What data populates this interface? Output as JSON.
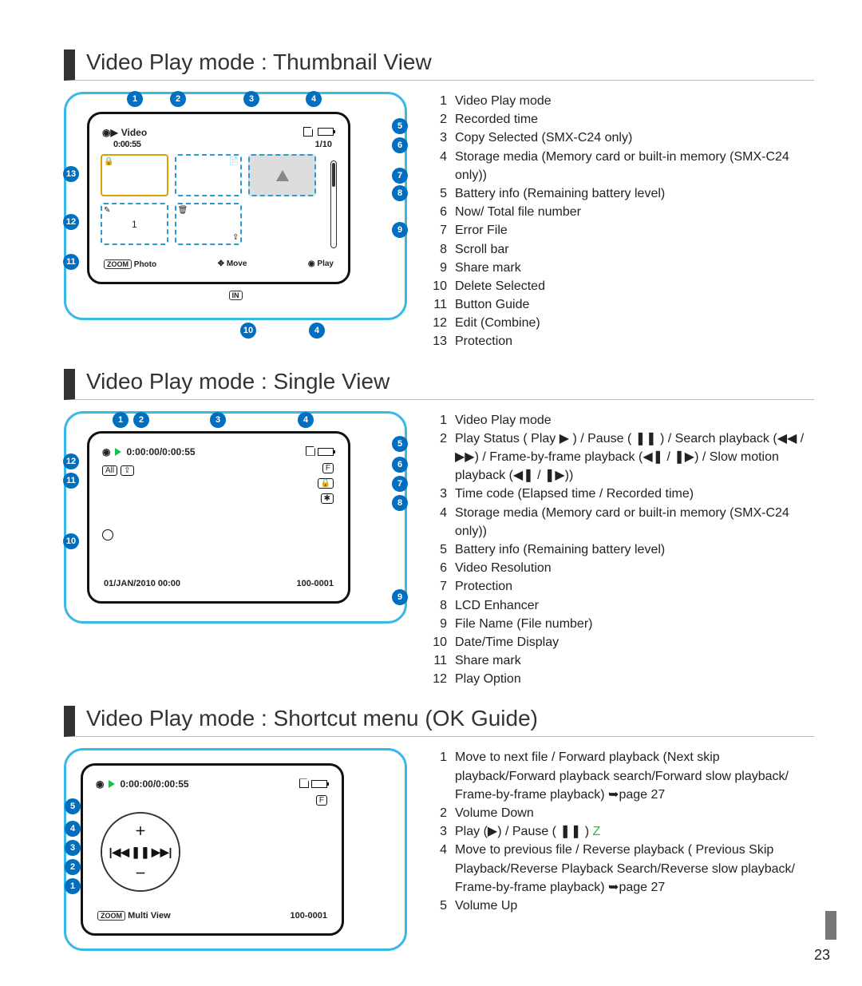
{
  "page_number": "23",
  "sections": {
    "thumbnail": {
      "title": "Video Play mode : Thumbnail View",
      "lcd": {
        "header_label": "Video",
        "recorded_time": "0:00:55",
        "counter": "1/10",
        "footer_photo": "Photo",
        "footer_move": "Move",
        "footer_play": "Play",
        "zoom_label": "ZOOM",
        "in_label": "IN",
        "combine_text": "1"
      },
      "legend": [
        "Video Play mode",
        "Recorded time",
        "Copy Selected (SMX-C24 only)",
        "Storage media (Memory card or built-in memory (SMX-C24 only))",
        "Battery info (Remaining battery level)",
        "Now/ Total ﬁle number",
        "Error File",
        "Scroll bar",
        "Share mark",
        "Delete Selected",
        "Button Guide",
        "Edit (Combine)",
        "Protection"
      ]
    },
    "single": {
      "title": "Video Play mode : Single View",
      "lcd": {
        "timecode": "0:00:00/0:00:55",
        "datetime": "01/JAN/2010 00:00",
        "filename": "100-0001",
        "all_label": "All"
      },
      "legend": [
        "Video Play mode",
        "Play Status ( Play ▶ ) / Pause ( ❚❚ ) /  Search playback (◀◀ / ▶▶) / Frame-by-frame playback (◀❚ / ❚▶) / Slow motion playback (◀❚ / ❚▶))",
        "Time code (Elapsed time / Recorded time)",
        "Storage media (Memory card or built-in memory (SMX-C24 only))",
        "Battery info (Remaining battery level)",
        "Video Resolution",
        "Protection",
        "LCD Enhancer",
        "File Name (File number)",
        "Date/Time Display",
        "Share mark",
        "Play Option"
      ]
    },
    "shortcut": {
      "title": "Video Play mode : Shortcut menu (OK Guide)",
      "lcd": {
        "timecode": "0:00:00/0:00:55",
        "multi_label": "Multi View",
        "zoom_label": "ZOOM",
        "filename": "100-0001"
      },
      "legend": [
        "Move to next ﬁle / Forward playback (Next skip playback/Forward playback search/Forward slow playback/ Frame-by-frame playback) ➥page 27",
        "Volume Down",
        "Play (▶) / Pause ( ❚❚ ) Z",
        "Move to previous ﬁle / Reverse playback ( Previous Skip Playback/Reverse Playback Search/Reverse slow playback/ Frame-by-frame playback) ➥page 27",
        "Volume Up"
      ]
    }
  }
}
